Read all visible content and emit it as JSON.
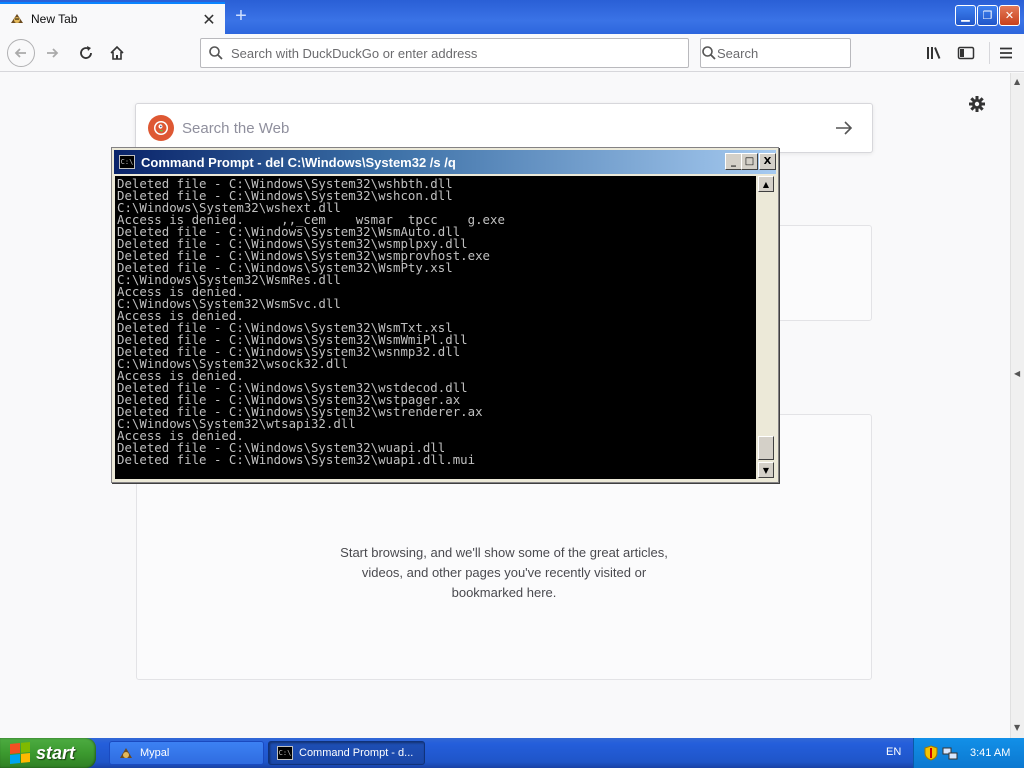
{
  "browser": {
    "tab": {
      "title": "New Tab",
      "close": "✕"
    },
    "newtab": "+",
    "window_controls": {
      "minimize": "▁",
      "maximize": "❐",
      "close": "✕"
    },
    "urlbar": {
      "placeholder": "Search with DuckDuckGo or enter address"
    },
    "searchbar": {
      "placeholder": "Search"
    },
    "icons": [
      "back-icon",
      "forward-icon",
      "reload-icon",
      "home-icon",
      "library-icon",
      "sidebar-icon",
      "menu-icon"
    ]
  },
  "newtab_page": {
    "websearch": {
      "placeholder": "Search the Web"
    },
    "highlights_message": [
      "Start browsing, and we'll show some of the great articles,",
      "videos, and other pages you've recently visited or",
      "bookmarked here."
    ]
  },
  "cmd": {
    "title": "Command Prompt - del C:\\Windows\\System32 /s /q",
    "controls": {
      "minimize": "_",
      "maximize": "□",
      "close": "X"
    },
    "icon_text": "C:\\",
    "lines": [
      "Deleted file - C:\\Windows\\System32\\wshbth.dll",
      "Deleted file - C:\\Windows\\System32\\wshcon.dll",
      "C:\\Windows\\System32\\wshext.dll",
      "Access is denied.     ,,_cem    wsmar  tpcc    g.exe",
      "Deleted file - C:\\Windows\\System32\\WsmAuto.dll",
      "Deleted file - C:\\Windows\\System32\\wsmplpxy.dll",
      "Deleted file - C:\\Windows\\System32\\wsmprovhost.exe",
      "Deleted file - C:\\Windows\\System32\\WsmPty.xsl",
      "C:\\Windows\\System32\\WsmRes.dll",
      "Access is denied.",
      "C:\\Windows\\System32\\WsmSvc.dll",
      "Access is denied.",
      "Deleted file - C:\\Windows\\System32\\WsmTxt.xsl",
      "Deleted file - C:\\Windows\\System32\\WsmWmiPl.dll",
      "Deleted file - C:\\Windows\\System32\\wsnmp32.dll",
      "C:\\Windows\\System32\\wsock32.dll",
      "Access is denied.",
      "Deleted file - C:\\Windows\\System32\\wstdecod.dll",
      "Deleted file - C:\\Windows\\System32\\wstpager.ax",
      "Deleted file - C:\\Windows\\System32\\wstrenderer.ax",
      "C:\\Windows\\System32\\wtsapi32.dll",
      "Access is denied.",
      "Deleted file - C:\\Windows\\System32\\wuapi.dll",
      "Deleted file - C:\\Windows\\System32\\wuapi.dll.mui"
    ],
    "scroll": {
      "up": "▲",
      "down": "▼"
    }
  },
  "taskbar": {
    "start_label": "start",
    "tasks": [
      {
        "label": "Mypal"
      },
      {
        "label": "Command Prompt - d..."
      }
    ],
    "language": "EN",
    "clock": "3:41 AM"
  },
  "colors": {
    "tab_accent": "#0a84ff",
    "duckduckgo": "#de5833",
    "xp_taskbar": "#245edb",
    "xp_start": "#3c9a2f"
  }
}
